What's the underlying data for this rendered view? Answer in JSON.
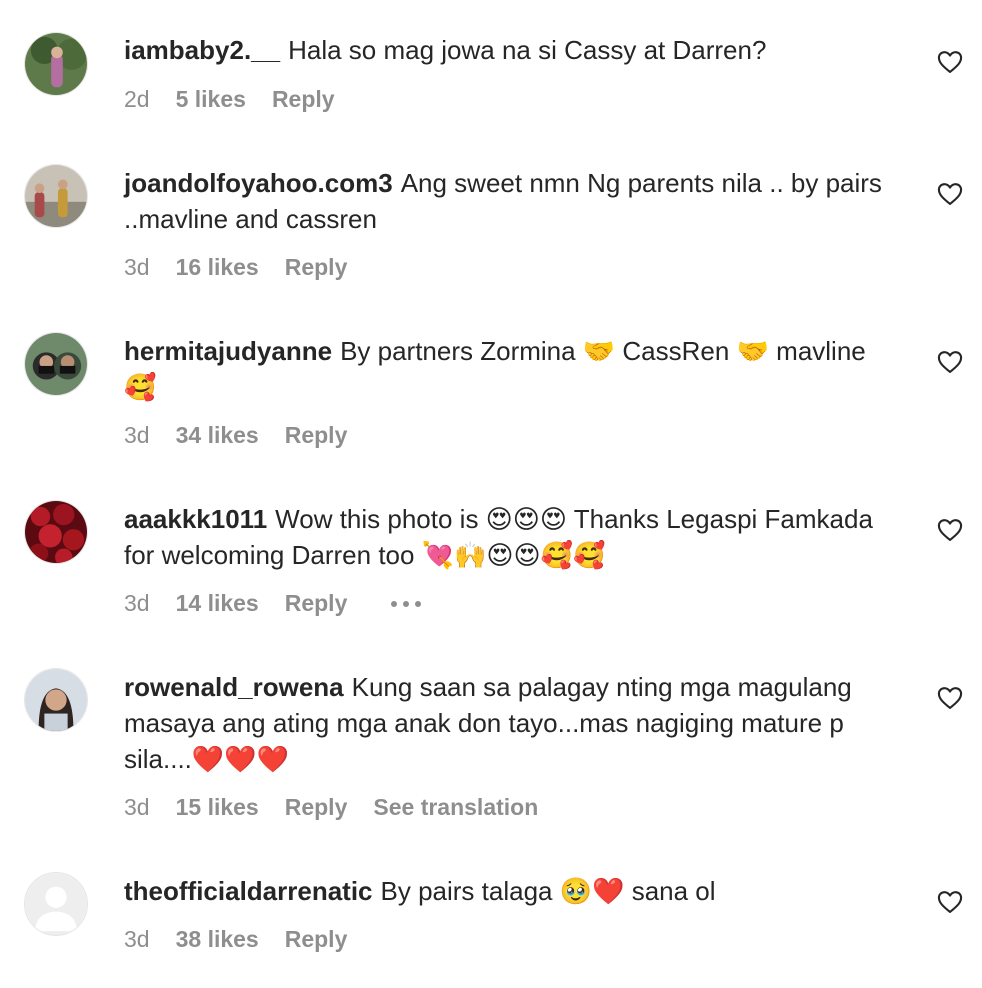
{
  "comments": [
    {
      "username": "iambaby2.__",
      "text": "Hala so mag jowa na si Cassy at Darren?",
      "time": "2d",
      "likes": "5 likes",
      "reply": "Reply"
    },
    {
      "username": "joandolfoyahoo.com3",
      "text": "Ang sweet nmn Ng parents nila .. by pairs ..mavline and cassren",
      "time": "3d",
      "likes": "16 likes",
      "reply": "Reply"
    },
    {
      "username": "hermitajudyanne",
      "text": "By partners Zormina 🤝 CassRen 🤝 mavline 🥰",
      "time": "3d",
      "likes": "34 likes",
      "reply": "Reply"
    },
    {
      "username": "aaakkk1011",
      "text": "Wow this photo is 😍😍😍 Thanks Legaspi Famkada for welcoming Darren too 💘🙌😍😍🥰🥰",
      "time": "3d",
      "likes": "14 likes",
      "reply": "Reply"
    },
    {
      "username": "rowenald_rowena",
      "text": "Kung saan sa palagay nting mga magulang masaya ang ating mga anak don tayo...mas nagiging mature p sila....❤️❤️❤️",
      "time": "3d",
      "likes": "15 likes",
      "reply": "Reply",
      "translation": "See translation"
    },
    {
      "username": "theofficialdarrenatic",
      "text": "By pairs talaga 🥹❤️ sana ol",
      "time": "3d",
      "likes": "38 likes",
      "reply": "Reply"
    }
  ]
}
